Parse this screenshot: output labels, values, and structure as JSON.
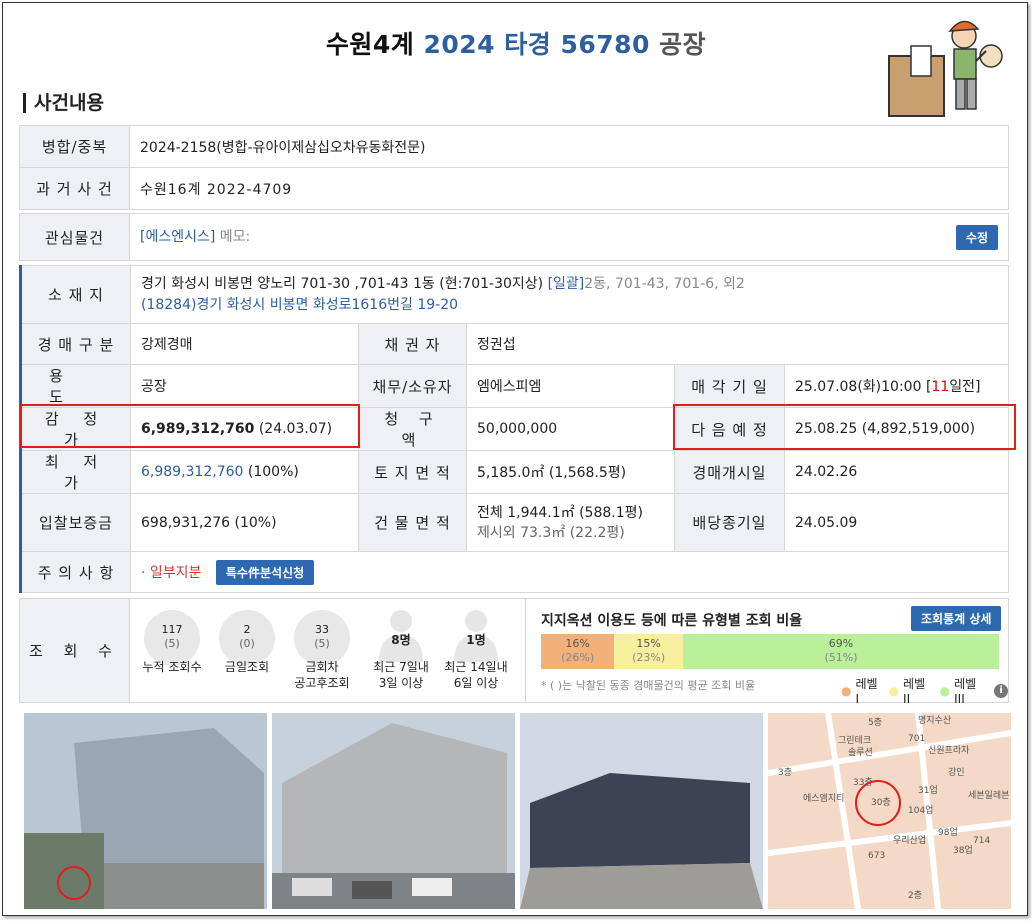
{
  "header": {
    "court": "수원4계",
    "case_no": "2024 타경 56780",
    "kind": "공장"
  },
  "section_title": "사건내용",
  "merge": {
    "label": "병합/중복",
    "value": "2024-2158(병합-유아이제삼십오차유동화전문)"
  },
  "past": {
    "label": "과 거 사 건",
    "value": "수원16계 2022-4709"
  },
  "interest": {
    "label": "관심물건",
    "tag": "[에스엔시스]",
    "memo": "메모:",
    "button": "수정"
  },
  "location": {
    "label": "소 재 지",
    "address": "경기 화성시 비봉면 양노리 701-30 ,701-43 1동 (현:701-30지상)",
    "bulk_link": "[일괄]",
    "bulk_rest": "2동, 701-43, 701-6, 외2",
    "road": "(18284)경기 화성시  비봉면 화성로1616번길  19-20"
  },
  "rows": [
    {
      "label": "경 매 구 분",
      "value": "강제경매",
      "label2": "채 권 자",
      "value2": "정권섭"
    },
    {
      "label": "용 도",
      "value": "공장",
      "label2": "채무/소유자",
      "value2": "엠에스피엠",
      "label3": "매 각 기 일",
      "value3a": "25.07.08(화)10:00 [",
      "value3b": "11",
      "value3c": "일전]"
    },
    {
      "label": "감 정 가",
      "value_bold": "6,989,312,760",
      "value_rest": " (24.03.07)",
      "label2": "청 구 액",
      "value2": "50,000,000",
      "label3": "다 음 예 정",
      "value3": "25.08.25 (4,892,519,000)"
    },
    {
      "label": "최 저 가",
      "value_link": "6,989,312,760",
      "value_rest": " (100%)",
      "label2": "토 지 면 적",
      "value2": "5,185.0㎡ (1,568.5평)",
      "label3": "경매개시일",
      "value3": "24.02.26"
    },
    {
      "label": "입찰보증금",
      "value": "698,931,276 (10%)",
      "label2": "건 물 면 적",
      "value2a": "전체 1,944.1㎡ (588.1평)",
      "value2b": "제시외 73.3㎡ (22.2평)",
      "label3": "배당종기일",
      "value3": "24.05.09"
    }
  ],
  "caution": {
    "label": "주 의 사 항",
    "note": "· 일부지분",
    "button": "특수件분석신청"
  },
  "views": {
    "label": "조 회 수",
    "items": [
      {
        "num": "117",
        "sub": "(5)",
        "label": "누적 조회수"
      },
      {
        "num": "2",
        "sub": "(0)",
        "label": "금일조회"
      },
      {
        "num": "33",
        "sub": "(5)",
        "label1": "금회차",
        "label2": "공고후조회"
      }
    ],
    "persons": [
      {
        "count": "8명",
        "label1": "최근 7일내",
        "label2": "3일 이상"
      },
      {
        "count": "1명",
        "label1": "최근 14일내",
        "label2": "6일 이상"
      }
    ],
    "ratio_title": "지지옥션 이용도 등에 따른 유형별 조회 비율",
    "ratio_button": "조회통계 상세",
    "bars": [
      {
        "pct": "16%",
        "avg": "(26%)",
        "color": "#f3b17a",
        "share": 0.16
      },
      {
        "pct": "15%",
        "avg": "(23%)",
        "color": "#f7ef9e",
        "share": 0.15
      },
      {
        "pct": "69%",
        "avg": "(51%)",
        "color": "#baf09a",
        "share": 0.69
      }
    ],
    "note": "* ( )는 낙찰된 동종 경매물건의 평균 조회 비율",
    "legend": [
      "레벨 I",
      "레벨 II",
      "레벨 III"
    ]
  },
  "map_labels": [
    "5층",
    "명지수산",
    "그린테크",
    "701",
    "신원프라자",
    "솔루션",
    "3층",
    "강인",
    "33층",
    "에스엠지티",
    "30층",
    "104업",
    "31업",
    "우리산업",
    "98업",
    "38업",
    "714",
    "673",
    "2층",
    "세븐일레븐"
  ]
}
